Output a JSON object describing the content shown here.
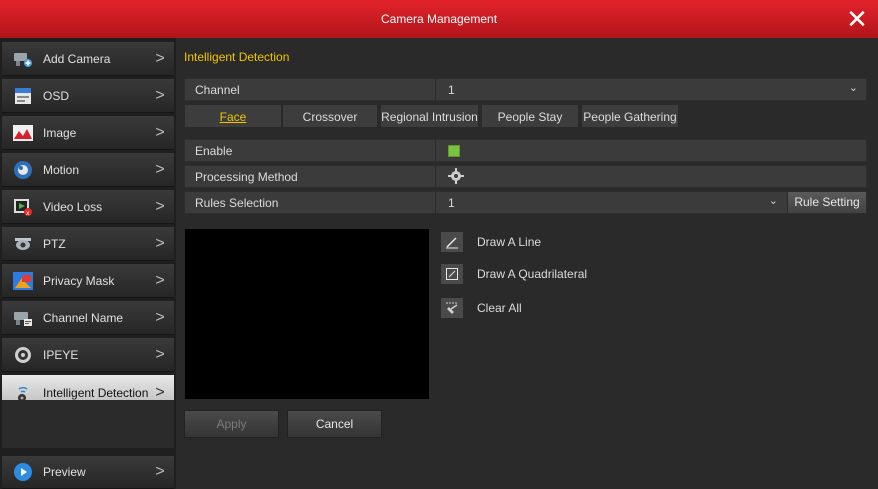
{
  "window": {
    "title": "Camera Management",
    "close_glyph": "✕"
  },
  "sidebar": {
    "items": [
      {
        "label": "Add Camera",
        "icon": "add-camera-icon"
      },
      {
        "label": "OSD",
        "icon": "osd-icon"
      },
      {
        "label": "Image",
        "icon": "image-icon"
      },
      {
        "label": "Motion",
        "icon": "motion-icon"
      },
      {
        "label": "Video Loss",
        "icon": "video-loss-icon"
      },
      {
        "label": "PTZ",
        "icon": "ptz-icon"
      },
      {
        "label": "Privacy Mask",
        "icon": "privacy-mask-icon"
      },
      {
        "label": "Channel Name",
        "icon": "channel-name-icon"
      },
      {
        "label": "IPEYE",
        "icon": "ipeye-icon"
      },
      {
        "label": "Intelligent Detection",
        "icon": "intelligent-detection-icon",
        "active": true
      },
      {
        "label": "Preview",
        "icon": "preview-icon"
      }
    ],
    "chevron": ">"
  },
  "main": {
    "section_title": "Intelligent Detection",
    "channel": {
      "label": "Channel",
      "value": "1"
    },
    "tabs": [
      {
        "label": "Face",
        "active": true
      },
      {
        "label": "Crossover"
      },
      {
        "label": "Regional Intrusion"
      },
      {
        "label": "People Stay"
      },
      {
        "label": "People Gathering"
      }
    ],
    "enable": {
      "label": "Enable",
      "checked": true
    },
    "processing": {
      "label": "Processing Method"
    },
    "rules": {
      "label": "Rules Selection",
      "value": "1",
      "button": "Rule Setting"
    },
    "tools": [
      {
        "label": "Draw A Line"
      },
      {
        "label": "Draw A Quadrilateral"
      },
      {
        "label": "Clear All"
      }
    ],
    "buttons": {
      "apply": "Apply",
      "cancel": "Cancel"
    }
  },
  "colors": {
    "accent": "#f2c500",
    "titlebar": "#d21c24",
    "check": "#7bc142"
  }
}
